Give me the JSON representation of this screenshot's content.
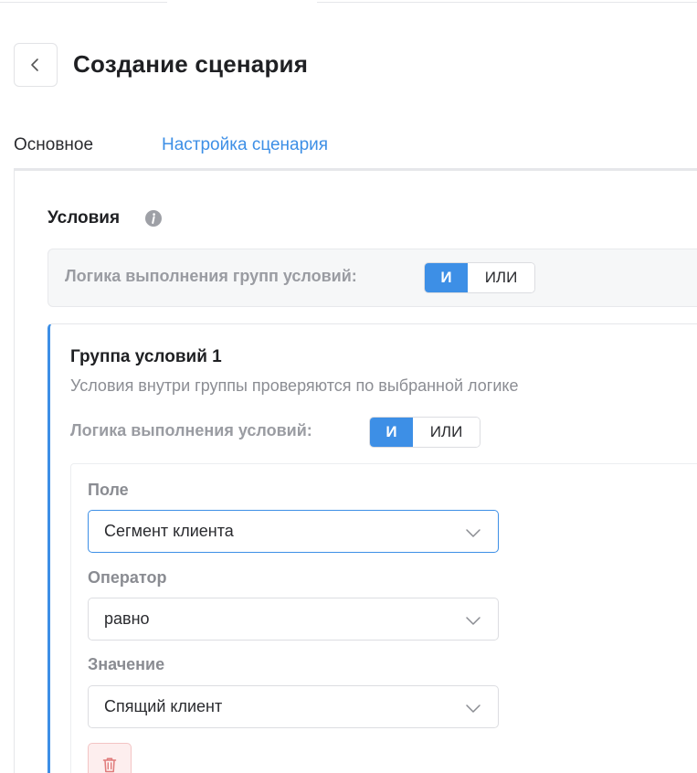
{
  "header": {
    "title": "Создание сценария"
  },
  "tabs": [
    {
      "label": "Основное",
      "active": false
    },
    {
      "label": "Настройка сценария",
      "active": true
    }
  ],
  "conditions": {
    "title": "Условия",
    "groups_logic": {
      "label": "Логика выполнения групп условий:",
      "options": [
        "И",
        "ИЛИ"
      ],
      "selected": "И"
    },
    "group": {
      "title": "Группа условий 1",
      "description": "Условия внутри группы проверяются по выбранной логике",
      "logic": {
        "label": "Логика выполнения условий:",
        "options": [
          "И",
          "ИЛИ"
        ],
        "selected": "И"
      },
      "condition": {
        "field": {
          "label": "Поле",
          "value": "Сегмент клиента"
        },
        "operator": {
          "label": "Оператор",
          "value": "равно"
        },
        "value": {
          "label": "Значение",
          "value": "Спящий клиент"
        }
      }
    }
  },
  "icons": {
    "back": "chevron-left-icon",
    "info": "info-icon",
    "dropdown": "chevron-down-icon",
    "delete": "trash-icon"
  },
  "colors": {
    "accent": "#3d8fe6",
    "danger": "#e07a7a",
    "muted_text": "#8a8c92"
  }
}
